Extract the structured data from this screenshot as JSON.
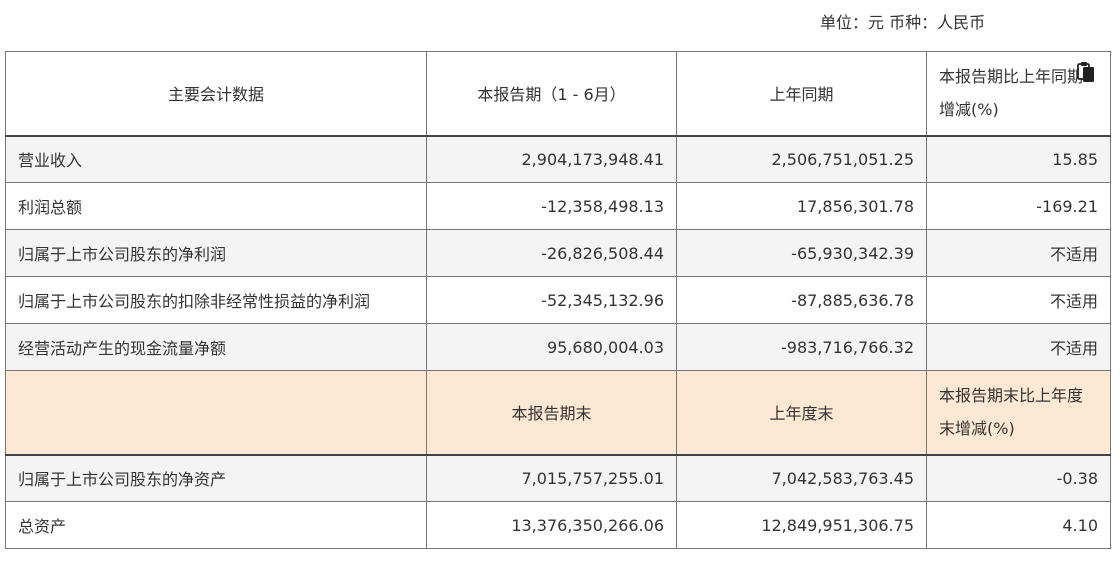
{
  "unit_line": "单位：元 币种：人民币",
  "table": {
    "header": [
      "主要会计数据",
      "本报告期（1 - 6月）",
      "上年同期",
      "本报告期比上年同期增减(%)"
    ],
    "rows1": [
      [
        "营业收入",
        "2,904,173,948.41",
        "2,506,751,051.25",
        "15.85"
      ],
      [
        "利润总额",
        "-12,358,498.13",
        "17,856,301.78",
        "-169.21"
      ],
      [
        "归属于上市公司股东的净利润",
        "-26,826,508.44",
        "-65,930,342.39",
        "不适用"
      ],
      [
        "归属于上市公司股东的扣除非经常性损益的净利润",
        "-52,345,132.96",
        "-87,885,636.78",
        "不适用"
      ],
      [
        "经营活动产生的现金流量净额",
        "95,680,004.03",
        "-983,716,766.32",
        "不适用"
      ]
    ],
    "mid_header": [
      "",
      "本报告期末",
      "上年度末",
      "本报告期末比上年度末增减(%)"
    ],
    "rows2": [
      [
        "归属于上市公司股东的净资产",
        "7,015,757,255.01",
        "7,042,583,763.45",
        "-0.38"
      ],
      [
        "总资产",
        "13,376,350,266.06",
        "12,849,951,306.75",
        "4.10"
      ]
    ]
  },
  "icons": {
    "header_corner": "copy-icon"
  }
}
